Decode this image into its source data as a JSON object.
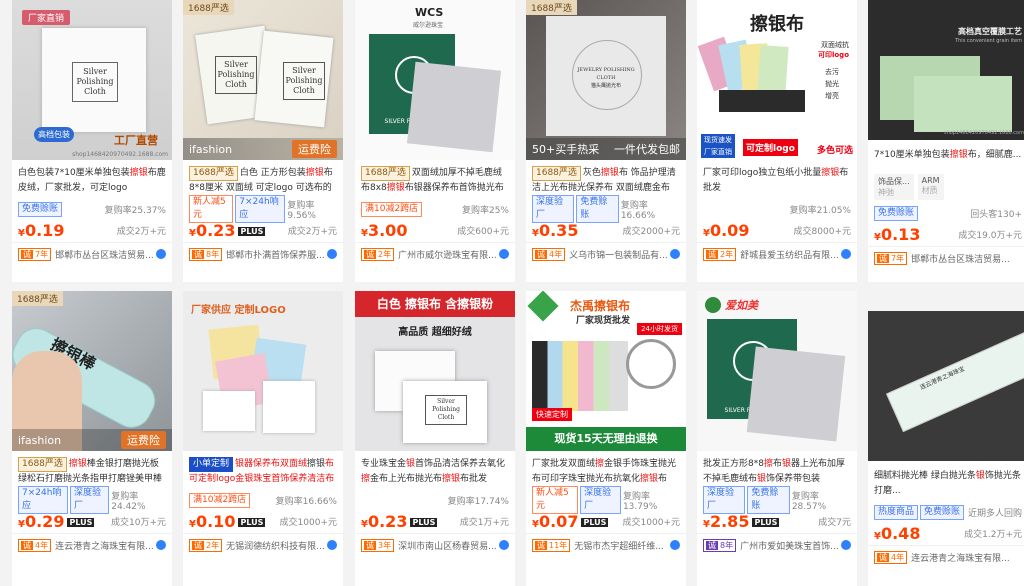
{
  "row1": [
    {
      "img": {
        "badge": "厂家直销",
        "footer_left": "高档包装",
        "footer_right": "工厂直营",
        "watermark": "shop1468420970492.1688.com",
        "card_text": "Silver\nPolishing\nCloth"
      },
      "title": [
        "白色包装7*10厘米单独包装",
        "擦银",
        "布鹿皮绒，厂家批发，可定logo"
      ],
      "tags": [
        {
          "text": "免费赊账",
          "style": "blue"
        }
      ],
      "stat": "复购率25.37%",
      "price_symbol": "¥",
      "price": "0.19",
      "plus": false,
      "sold": "成交2万+元",
      "shop_year": "7年",
      "shop": "邯郸市丛台区珠洁贸易..."
    },
    {
      "img": {
        "badge": "1688严选",
        "footer_left": "ifashion",
        "footer_right": "运费险",
        "card_text": "Silver\nPolishing\nCloth"
      },
      "title": [
        "1688严选",
        "白色 正方形包装",
        "擦银",
        "布8*8厘米 双面绒 可定logo 可选布的"
      ],
      "tags": [
        {
          "text": "新人减5元",
          "style": "red-outline"
        },
        {
          "text": "7×24h响应",
          "style": "blue"
        }
      ],
      "stat": "复购率9.56%",
      "price_symbol": "¥",
      "price": "0.23",
      "plus": true,
      "sold": "成交2万+元",
      "shop_year": "8年",
      "shop": "邯郸市扑满首饰保养服..."
    },
    {
      "img": {
        "logo": "WCS",
        "logo_sub": "威尔逊珠宝",
        "cloth_label": "SILVER POLISHING"
      },
      "title": [
        "1688严选",
        "双面绒加厚不掉毛鹿绒布8x8",
        "擦银",
        "布银器保养布首饰抛光布饰"
      ],
      "tags": [
        {
          "text": "满10减2跨店",
          "style": "red-outline"
        }
      ],
      "stat": "复购率25%",
      "price_symbol": "¥",
      "price": "3.00",
      "plus": false,
      "sold": "成交600+元",
      "shop_year": "2年",
      "shop": "广州市威尔逊珠宝有限..."
    },
    {
      "img": {
        "badge": "1688严选",
        "footer_left": "50+买手热采",
        "footer_right": "一件代发包邮",
        "card_text": "JEWELRY POLISHING CLOTH\n猫头鹰抛光布"
      },
      "title": [
        "1688严选",
        "灰色",
        "擦银",
        "布 饰品护理清洁上光布抛光保养布 双面绒鹿金布"
      ],
      "tags": [
        {
          "text": "深度验厂",
          "style": "blue"
        },
        {
          "text": "免费赊账",
          "style": "blue"
        }
      ],
      "stat": "复购率16.66%",
      "price_symbol": "¥",
      "price": "0.35",
      "plus": false,
      "sold": "成交2000+元",
      "shop_year": "4年",
      "shop": "义乌市锦一包装制品有..."
    },
    {
      "img": {
        "head": "擦银布",
        "side1": "双面绒抗",
        "side2": "可印logo",
        "bullets": [
          "去污",
          "抛光",
          "增亮"
        ],
        "foot1": "现货速发",
        "foot2": "厂家直销",
        "foot3": "可定制logo",
        "foot4": "多色可选"
      },
      "title": [
        "厂家可印logo独立包纸小批量",
        "擦银",
        "布批发"
      ],
      "tags": [],
      "stat": "复购率21.05%",
      "price_symbol": "¥",
      "price": "0.09",
      "plus": false,
      "sold": "成交8000+元",
      "shop_year": "2年",
      "shop": "舒城县爱玉纺织品有限..."
    },
    {
      "img": {
        "head": "高档真空覆膜工艺",
        "sub": "This convenient grain item",
        "watermark": "shop1468420970492.1688.com"
      },
      "title": [
        "7*10厘米单独包装",
        "擦银",
        "布，细腻鹿..."
      ],
      "tags": [],
      "attrs": [
        {
          "k": "饰品保...",
          "v": "神弛"
        },
        {
          "k": "ARM",
          "v": "材质"
        }
      ],
      "extra_tag": "免费赊账",
      "extra_right": "回头客130+",
      "price_symbol": "¥",
      "price": "0.13",
      "plus": false,
      "sold": "成交19.0万+元",
      "shop_year": "7年",
      "shop": "邯郸市丛台区珠洁贸易..."
    }
  ],
  "row2": [
    {
      "img": {
        "badge": "1688严选",
        "footer_left": "ifashion",
        "footer_right": "运费险",
        "stick_text": "擦银棒"
      },
      "title": [
        "1688严选",
        "擦银",
        "棒金银打磨抛光板绿松石打磨抛光条指甲打磨锉美甲棒"
      ],
      "tags": [
        {
          "text": "7×24h响应",
          "style": "blue"
        },
        {
          "text": "深度验厂",
          "style": "blue"
        }
      ],
      "stat": "复购率24.42%",
      "price_symbol": "¥",
      "price": "0.29",
      "plus": true,
      "sold": "成交10万+元",
      "shop_year": "4年",
      "shop": "连云港青之海珠宝有限..."
    },
    {
      "img": {
        "head": "厂家供应 定制LOGO"
      },
      "title": [
        "小单定制",
        "银器保养布双面绒",
        "擦银",
        "布可定制logo金银珠宝首饰保养清洁布"
      ],
      "tags": [
        {
          "text": "满10减2跨店",
          "style": "red-outline"
        }
      ],
      "stat": "复购率16.66%",
      "price_symbol": "¥",
      "price": "0.10",
      "plus": true,
      "sold": "成交1000+元",
      "shop_year": "2年",
      "shop": "无锡润德纺织科技有限..."
    },
    {
      "img": {
        "banner": "白色 擦银布 含擦银粉",
        "sub": "高品质 超细好绒",
        "card_text": "Silver\nPolishing\nCloth"
      },
      "title": [
        "专业珠宝金",
        "银",
        "首饰品清洁保养去氧化",
        "擦",
        "金布上光布抛光布",
        "擦银",
        "布批发"
      ],
      "tags": [],
      "stat": "复购率17.74%",
      "price_symbol": "¥",
      "price": "0.23",
      "plus": true,
      "sold": "成交1万+元",
      "shop_year": "3年",
      "shop": "深圳市南山区杨春贸易..."
    },
    {
      "img": {
        "brand": "杰禹擦银布",
        "brand_sub": "厂家现货批发",
        "badge_ship": "24小时发货",
        "custom": "快速定制",
        "foot": "现货15天无理由退换"
      },
      "title": [
        "厂家批发双面绒",
        "擦",
        "金银手饰珠宝抛光布可印字珠宝抛光布抗氧化",
        "擦银",
        "布"
      ],
      "tags": [
        {
          "text": "新人减5元",
          "style": "red-outline"
        },
        {
          "text": "深度验厂",
          "style": "blue"
        }
      ],
      "stat": "复购率13.79%",
      "price_symbol": "¥",
      "price": "0.07",
      "plus": true,
      "sold": "成交1000+元",
      "shop_year": "11年",
      "shop": "无锡市杰宇超细纤维..."
    },
    {
      "img": {
        "brand": "爱如美",
        "cloth_label": "SILVER POLISHING"
      },
      "title": [
        "批发正方形8*8",
        "擦",
        "布",
        "银",
        "器上光布加厚不掉毛鹿绒布",
        "银",
        "饰保养带包装"
      ],
      "tags": [
        {
          "text": "深度验厂",
          "style": "blue"
        },
        {
          "text": "免费赊账",
          "style": "blue"
        }
      ],
      "stat": "复购率28.57%",
      "price_symbol": "¥",
      "price": "2.85",
      "plus": true,
      "sold": "成交7元",
      "shop_year": "8年",
      "shop": "广州市爱如美珠宝首饰..."
    },
    {
      "img": {
        "stick_text": "连云港青之海珠宝"
      },
      "title": [
        "细腻料抛光棒 绿白抛光条",
        "银",
        "饰抛光条打磨..."
      ],
      "tags": [
        {
          "text": "热度商品",
          "style": "blue"
        },
        {
          "text": "免费赊账",
          "style": "blue"
        }
      ],
      "stat": "近期多人回购",
      "price_symbol": "¥",
      "price": "0.48",
      "plus": false,
      "sold": "成交1.2万+元",
      "shop_year": "4年",
      "shop": "连云港青之海珠宝有限..."
    }
  ]
}
